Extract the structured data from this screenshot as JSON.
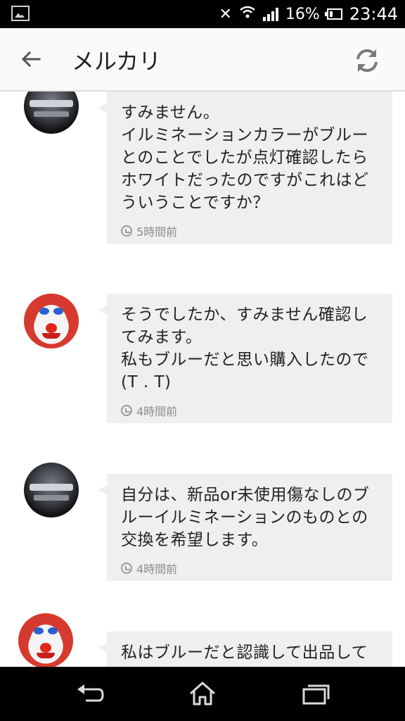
{
  "status_bar": {
    "battery_percent": "16%",
    "time": "23:44",
    "icons": [
      "gallery-icon",
      "mute-icon",
      "wifi-icon",
      "signal-icon",
      "battery-icon"
    ]
  },
  "app_bar": {
    "title": "メルカリ",
    "back_icon": "back-arrow-icon",
    "refresh_icon": "refresh-icon"
  },
  "messages": [
    {
      "avatar": "car",
      "text": "すみません。\nイルミネーションカラーがブルーとのことでしたが点灯確認したらホワイトだったのですがこれはどういうことですか？",
      "time": "5時間前"
    },
    {
      "avatar": "clown",
      "text": "そうでしたか、すみません確認してみます。\n私もブルーだと思い購入したので(T . T)",
      "time": "4時間前"
    },
    {
      "avatar": "car",
      "text": "自分は、新品or未使用傷なしのブルーイルミネーションのものとの交換を希望します。",
      "time": "4時間前"
    },
    {
      "avatar": "clown",
      "text": "私はブルーだと認識して出品して",
      "time": ""
    }
  ],
  "nav_bar": {
    "icons": [
      "back-icon",
      "home-icon",
      "recent-apps-icon"
    ]
  }
}
